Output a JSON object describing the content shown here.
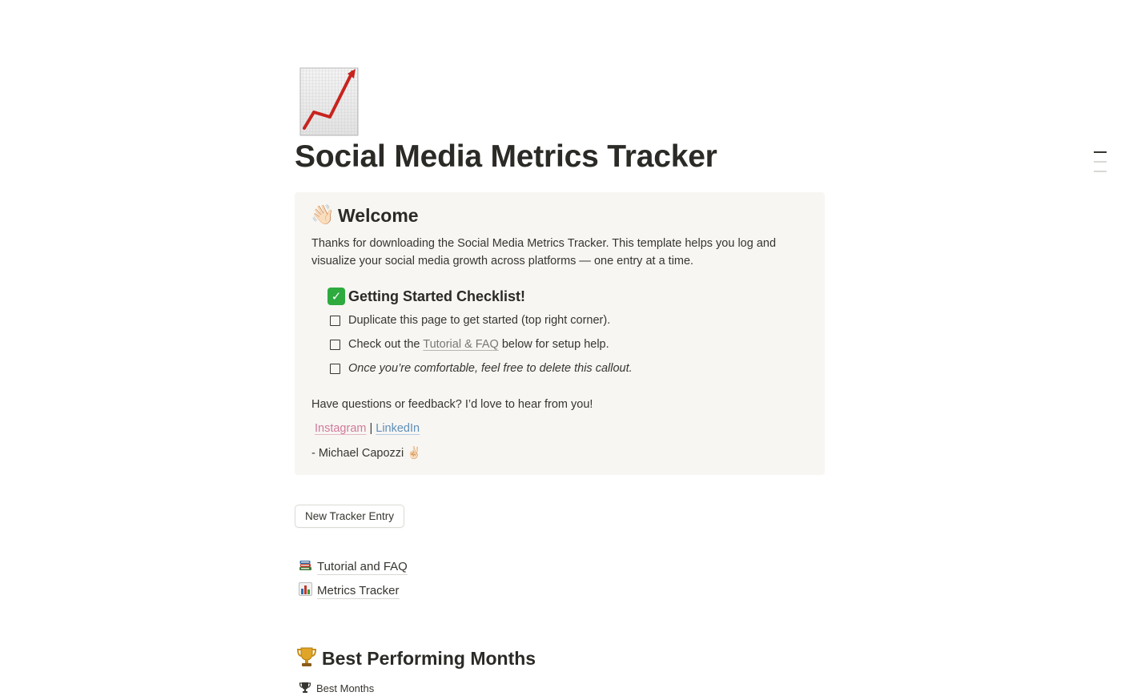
{
  "page": {
    "icon": "chart-increasing-icon",
    "title": "Social Media Metrics Tracker"
  },
  "callout": {
    "icon": "waving-hand-icon",
    "heading": "Welcome",
    "intro": "Thanks for downloading the Social Media Metrics Tracker. This template helps you log and visualize your social media growth across platforms — one entry at a time.",
    "checklist": {
      "icon": "check-mark-button-icon",
      "heading": "Getting Started Checklist!",
      "items": [
        {
          "text": "Duplicate this page to get started (top right corner).",
          "checked": false
        },
        {
          "before": "Check out the ",
          "link": "Tutorial & FAQ",
          "after": " below for setup help.",
          "checked": false
        },
        {
          "text": "Once you’re comfortable, feel free to delete this callout.",
          "checked": false
        }
      ]
    },
    "feedback": "Have questions or feedback? I’d love to hear from you!",
    "links": {
      "instagram": "Instagram",
      "separator": "|",
      "linkedin": "LinkedIn"
    },
    "signature": "- Michael Capozzi ✌🏻"
  },
  "button": {
    "new_entry": "New Tracker Entry"
  },
  "page_links": [
    {
      "icon": "books-icon",
      "label": "Tutorial and FAQ"
    },
    {
      "icon": "bar-chart-icon",
      "label": "Metrics Tracker"
    }
  ],
  "section": {
    "icon": "trophy-icon",
    "heading": "Best Performing Months",
    "view_icon": "trophy-icon",
    "view_label": "Best Months"
  },
  "colors": {
    "text": "#37352f",
    "callout_bg": "#f7f6f3",
    "instagram_link": "#d17a9a",
    "linkedin_link": "#5f8fb8",
    "muted_link": "#787774",
    "chart_line": "#c8231d"
  }
}
